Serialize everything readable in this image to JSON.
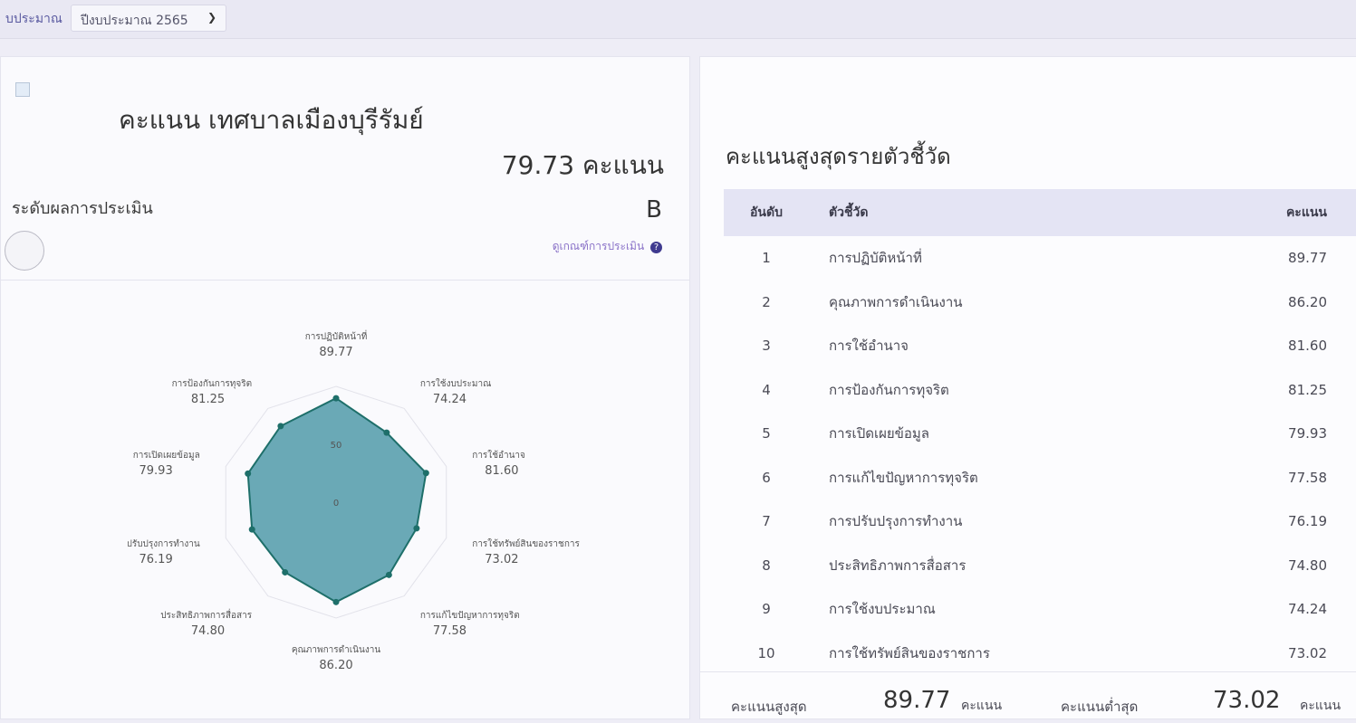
{
  "topbar": {
    "label": "บประมาณ",
    "year_select": "ปีงบประมาณ 2565"
  },
  "left": {
    "org_title": "คะแนน เทศบาลเมืองบุรีรัมย์",
    "total_score": "79.73 คะแนน",
    "level_label": "ระดับผลการประเมิน",
    "grade": "B",
    "criteria_link": "ดูเกณฑ์การประเมิน",
    "radar": {
      "center_label": "0",
      "ring_label": "50",
      "axes": [
        {
          "label": "การปฏิบัติหน้าที่",
          "value": "89.77"
        },
        {
          "label": "การใช้งบประมาณ",
          "value": "74.24"
        },
        {
          "label": "การใช้อำนาจ",
          "value": "81.60"
        },
        {
          "label": "การใช้ทรัพย์สินของราชการ",
          "value": "73.02"
        },
        {
          "label": "การแก้ไขปัญหาการทุจริต",
          "value": "77.58"
        },
        {
          "label": "คุณภาพการดำเนินงาน",
          "value": "86.20"
        },
        {
          "label": "ประสิทธิภาพการสื่อสาร",
          "value": "74.80"
        },
        {
          "label": "การปรับปรุงการทำงาน",
          "value": "76.19"
        },
        {
          "label": "การเปิดเผยข้อมูล",
          "value": "79.93"
        },
        {
          "label": "การป้องกันการทุจริต",
          "value": "81.25"
        }
      ]
    }
  },
  "right": {
    "title": "คะแนนสูงสุดรายตัวชี้วัด",
    "headers": {
      "rank": "อันดับ",
      "name": "ตัวชี้วัด",
      "score": "คะแนน"
    },
    "rows": [
      {
        "rank": "1",
        "name": "การปฏิบัติหน้าที่",
        "score": "89.77"
      },
      {
        "rank": "2",
        "name": "คุณภาพการดำเนินงาน",
        "score": "86.20"
      },
      {
        "rank": "3",
        "name": "การใช้อำนาจ",
        "score": "81.60"
      },
      {
        "rank": "4",
        "name": "การป้องกันการทุจริต",
        "score": "81.25"
      },
      {
        "rank": "5",
        "name": "การเปิดเผยข้อมูล",
        "score": "79.93"
      },
      {
        "rank": "6",
        "name": "การแก้ไขปัญหาการทุจริต",
        "score": "77.58"
      },
      {
        "rank": "7",
        "name": "การปรับปรุงการทำงาน",
        "score": "76.19"
      },
      {
        "rank": "8",
        "name": "ประสิทธิภาพการสื่อสาร",
        "score": "74.80"
      },
      {
        "rank": "9",
        "name": "การใช้งบประมาณ",
        "score": "74.24"
      },
      {
        "rank": "10",
        "name": "การใช้ทรัพย์สินของราชการ",
        "score": "73.02"
      }
    ],
    "summary": {
      "max_label": "คะแนนสูงสุด",
      "max_value": "89.77",
      "min_label": "คะแนนต่ำสุด",
      "min_value": "73.02",
      "unit": "คะแนน"
    }
  },
  "colors": {
    "radar_fill": "#6aa9b6",
    "radar_stroke": "#1e6f6a"
  }
}
